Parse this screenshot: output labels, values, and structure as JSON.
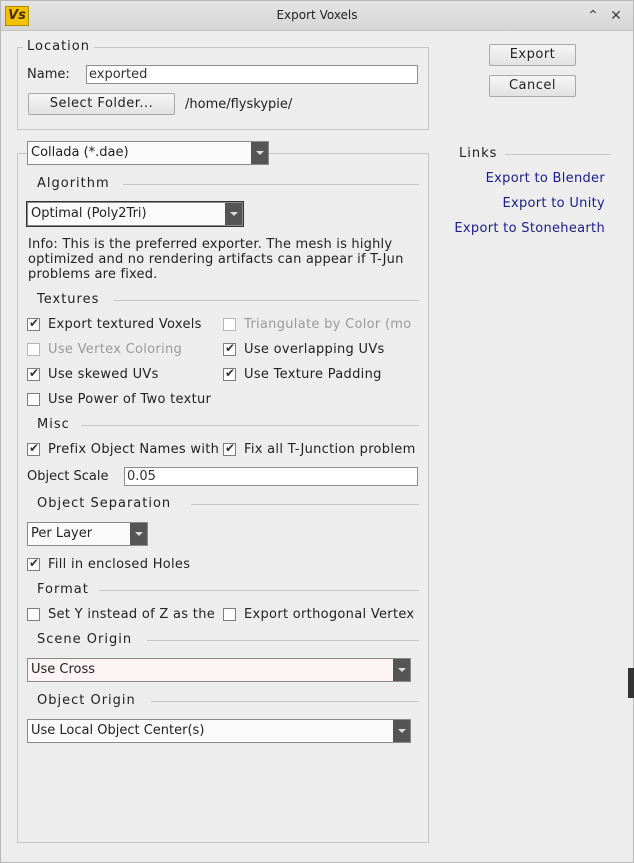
{
  "window": {
    "title": "Export Voxels",
    "app_icon": "Vs",
    "minimize_glyph": "⌃",
    "close_glyph": "✕"
  },
  "location": {
    "legend": "Location",
    "name_label": "Name:",
    "name_value": "exported",
    "select_folder_label": "Select Folder...",
    "folder_path": "/home/flyskypie/"
  },
  "actions": {
    "export_label": "Export",
    "cancel_label": "Cancel"
  },
  "format_combo": "Collada (*.dae)",
  "algorithm": {
    "legend": "Algorithm",
    "selected": "Optimal (Poly2Tri)",
    "info_lines": [
      "Info: This is the preferred exporter. The mesh is highly",
      "optimized and no rendering artifacts can appear if T-Jun",
      "problems are fixed."
    ]
  },
  "textures": {
    "legend": "Textures",
    "options": [
      {
        "label": "Export textured Voxels",
        "checked": true,
        "disabled": false
      },
      {
        "label": "Triangulate by Color (mo",
        "checked": false,
        "disabled": true
      },
      {
        "label": "Use Vertex Coloring",
        "checked": false,
        "disabled": true
      },
      {
        "label": "Use overlapping UVs",
        "checked": true,
        "disabled": false
      },
      {
        "label": "Use skewed UVs",
        "checked": true,
        "disabled": false
      },
      {
        "label": "Use Texture Padding",
        "checked": true,
        "disabled": false
      },
      {
        "label": "Use Power of Two textur",
        "checked": false,
        "disabled": false
      }
    ]
  },
  "misc": {
    "legend": "Misc",
    "options": [
      {
        "label": "Prefix Object Names with",
        "checked": true
      },
      {
        "label": "Fix all T-Junction problem",
        "checked": true
      }
    ],
    "scale_label": "Object Scale",
    "scale_value": "0.05"
  },
  "object_separation": {
    "legend": "Object Separation",
    "selected": "Per Layer",
    "fill_holes_label": "Fill in enclosed Holes",
    "fill_holes_checked": true
  },
  "format": {
    "legend": "Format",
    "options": [
      {
        "label": "Set Y instead of Z as the",
        "checked": false
      },
      {
        "label": "Export orthogonal Vertex",
        "checked": false
      }
    ]
  },
  "scene_origin": {
    "legend": "Scene Origin",
    "selected": "Use Cross"
  },
  "object_origin": {
    "legend": "Object Origin",
    "selected": "Use Local Object Center(s)"
  },
  "links": {
    "legend": "Links",
    "items": [
      "Export to Blender",
      "Export to Unity",
      "Export to Stonehearth"
    ]
  }
}
